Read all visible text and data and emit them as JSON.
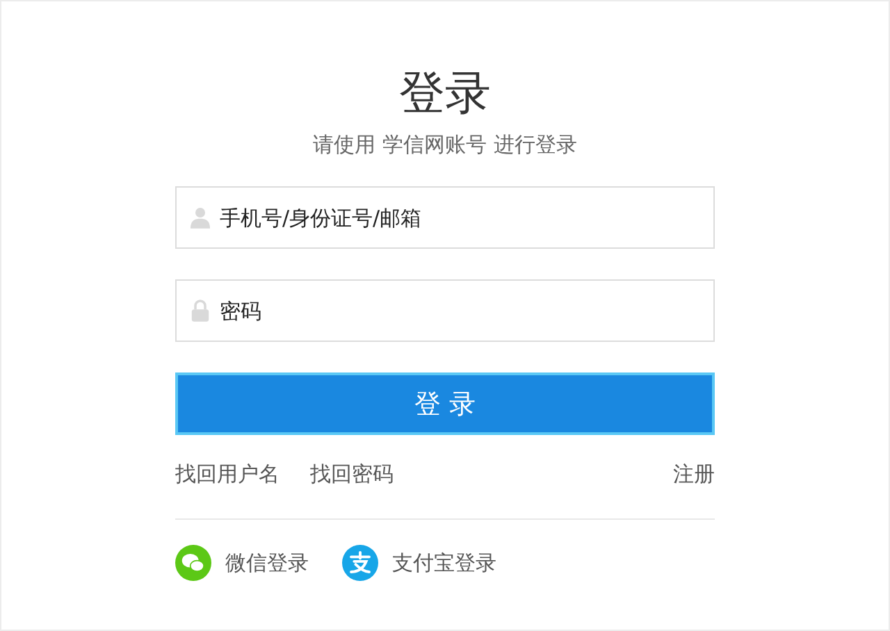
{
  "title": "登录",
  "subtitle": "请使用 学信网账号 进行登录",
  "fields": [
    {
      "kind": "user",
      "placeholder": "手机号/身份证号/邮箱"
    },
    {
      "kind": "password",
      "placeholder": "密码"
    }
  ],
  "submit": "登 录",
  "links": [
    "找回用户名",
    "找回密码"
  ],
  "register": "注册",
  "social": [
    {
      "kind": "wechat",
      "label": "微信登录"
    },
    {
      "kind": "alipay",
      "label": "支付宝登录"
    }
  ]
}
